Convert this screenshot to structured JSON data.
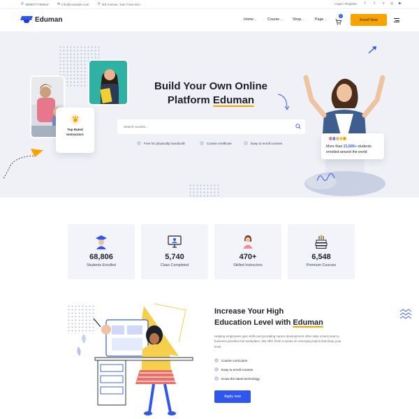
{
  "topbar": {
    "phone": "8809077768544",
    "email": "info@example.com",
    "address": "3rd Avenue, San Francisco",
    "login": "Login / Register",
    "social_icons": [
      "facebook-icon",
      "twitter-icon",
      "vimeo-icon",
      "instagram-icon",
      "youtube-icon"
    ]
  },
  "header": {
    "brand": "Eduman",
    "nav": [
      "Home",
      "Course",
      "Shop",
      "Page"
    ],
    "cart_count": "2",
    "enroll_label": "Enroll Now"
  },
  "hero": {
    "title_line1": "Build Your Own Online",
    "title_line2_prefix": "Platform",
    "title_line2_highlight": "Eduman",
    "search_placeholder": "Search courses...",
    "features": [
      "Free for physically handicraft",
      "Course certificate",
      "Easy to enroll courses"
    ],
    "badge_line1": "Top Rated",
    "badge_line2": "Instructors",
    "students_prefix": "More than",
    "students_count": "21,500+",
    "students_suffix": "students",
    "students_line2": "enrolled around the world"
  },
  "stats": [
    {
      "value": "68,806",
      "label": "Students Enrolled",
      "icon": "graduate-icon"
    },
    {
      "value": "5,740",
      "label": "Class Completed",
      "icon": "monitor-icon"
    },
    {
      "value": "470+",
      "label": "Skilled Instructors",
      "icon": "instructor-icon"
    },
    {
      "value": "6,548",
      "label": "Premium Courses",
      "icon": "books-icon"
    }
  ],
  "about": {
    "title_line1": "Increase Your High",
    "title_line2_prefix": "Education Level with",
    "title_line2_highlight": "Eduman",
    "description": "Helping employees gain skills and providing career development often take a back seat to business priorities but workplace. We offer fresh courses on emerging topics that keep your level.",
    "list": [
      "Course curriculum",
      "Easy to enroll courses",
      "Know the latest technology"
    ],
    "button": "Apply now"
  },
  "colors": {
    "primary": "#2f57ef",
    "accent": "#f9a200",
    "hero_bg": "#eff1f6",
    "stat_bg": "#f2f4f9",
    "text": "#1d2026"
  }
}
